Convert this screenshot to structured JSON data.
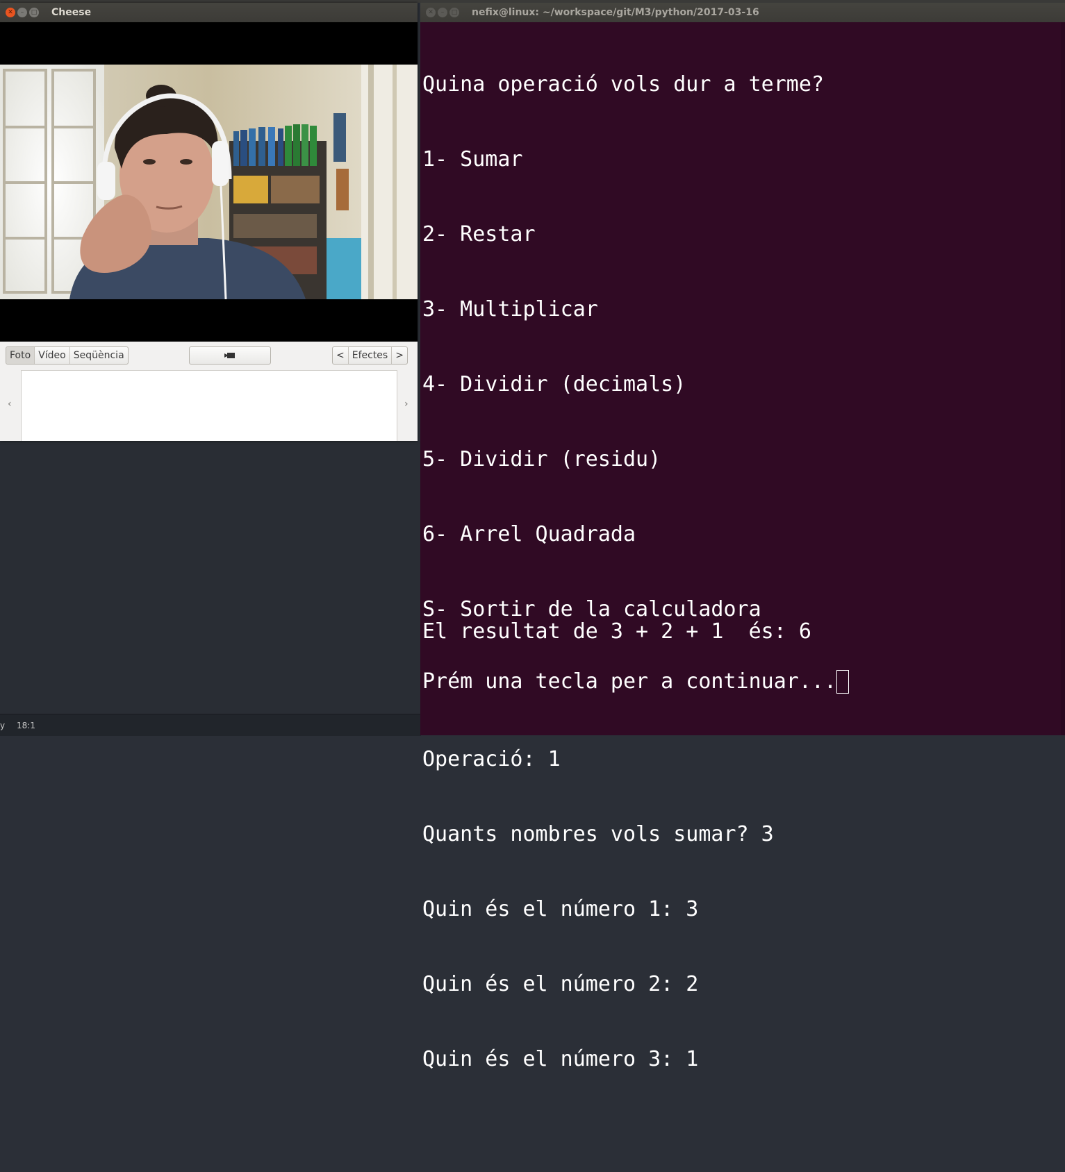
{
  "cheese": {
    "title": "Cheese",
    "modes": [
      "Foto",
      "Vídeo",
      "Seqüència"
    ],
    "active_mode": "Foto",
    "effects_label": "Efectes",
    "prev_arrow": "‹",
    "next_arrow": "›"
  },
  "terminal": {
    "title": "nefix@linux: ~/workspace/git/M3/python/2017-03-16",
    "lines": [
      "Quina operació vols dur a terme?",
      "1- Sumar",
      "2- Restar",
      "3- Multiplicar",
      "4- Dividir (decimals)",
      "5- Dividir (residu)",
      "6- Arrel Quadrada",
      "S- Sortir de la calculadora",
      "",
      "Operació: 1",
      "Quants nombres vols sumar? 3",
      "Quin és el número 1: 3",
      "Quin és el número 2: 2",
      "Quin és el número 3: 1"
    ],
    "result": "El resultat de 3 + 2 + 1  és: 6",
    "prompt": "Prém una tecla per a continuar..."
  },
  "editor_status": {
    "left_fragment": "y",
    "position": "18:1"
  },
  "colors": {
    "terminal_bg": "#300a24",
    "close_button": "#e95420",
    "titlebar": "#3c3b37"
  }
}
